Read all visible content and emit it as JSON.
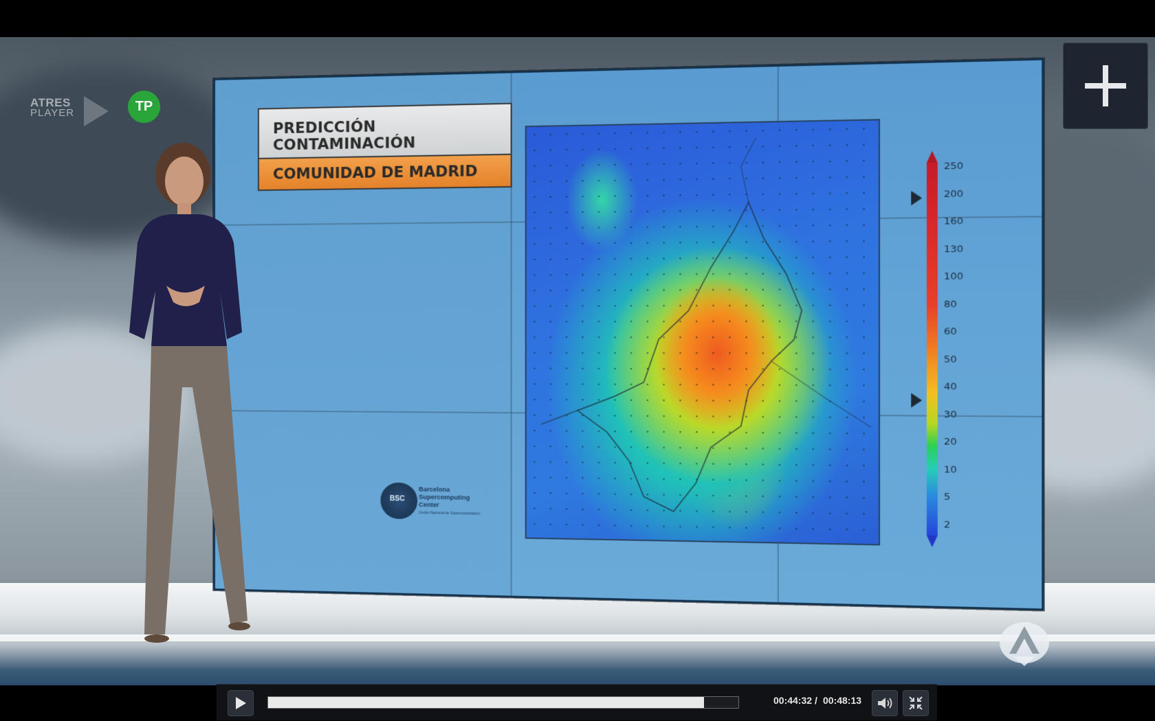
{
  "player": {
    "brand_logo_line1": "ATRES",
    "brand_logo_line2": "PLAYER",
    "channel_badge": "TP",
    "plus_button_icon": "plus-icon",
    "network_logo_icon": "antena3-logo"
  },
  "broadcast": {
    "title_line1": "PREDICCIÓN CONTAMINACIÓN",
    "title_line2": "COMUNIDAD DE MADRID",
    "bsc_logo_initials": "BSC",
    "bsc_logo_name": [
      "Barcelona",
      "Supercomputing",
      "Center"
    ],
    "bsc_logo_subtitle": "Centro Nacional de Supercomputación",
    "scale_labels": [
      "250",
      "200",
      "160",
      "130",
      "100",
      "80",
      "60",
      "50",
      "40",
      "30",
      "20",
      "10",
      "5",
      "2"
    ],
    "scale_marker_values": [
      "200",
      "40"
    ]
  },
  "controls": {
    "play_icon": "play-icon",
    "current_time": "00:44:32",
    "separator": "/",
    "total_time": "00:48:13",
    "progress_fraction": 0.924,
    "volume_icon": "volume-icon",
    "exit_fullscreen_icon": "exit-fullscreen-icon"
  }
}
